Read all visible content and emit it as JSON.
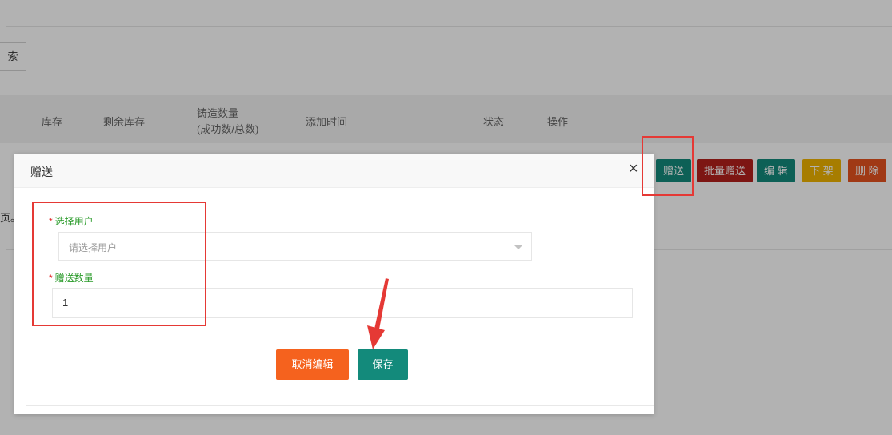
{
  "background_page": {
    "search_button_label": "索",
    "table_headers": {
      "stock": "库存",
      "remaining_stock": "剩余库存",
      "mint_count_line1": "铸造数量",
      "mint_count_line2": "(成功数/总数)",
      "added_time": "添加时间",
      "status": "状态",
      "actions": "操作"
    },
    "row_actions": {
      "gift": "赠送",
      "batch_gift": "批量赠送",
      "edit": "编 辑",
      "unlist": "下 架",
      "delete": "删 除"
    },
    "truncated_text": "页。"
  },
  "modal": {
    "title": "赠送",
    "close_symbol": "×",
    "fields": {
      "user": {
        "required_mark": "*",
        "label": "选择用户",
        "placeholder": "请选择用户"
      },
      "quantity": {
        "required_mark": "*",
        "label": "赠送数量",
        "value": "1"
      }
    },
    "buttons": {
      "cancel": "取消编辑",
      "save": "保存"
    }
  },
  "colors": {
    "gift_button": "#138a7b",
    "batch_gift_button": "#b3201c",
    "edit_button": "#138a7b",
    "unlist_button": "#f0b400",
    "delete_button": "#e6521f",
    "cancel_button": "#f5621e",
    "save_button": "#138a7b",
    "annotation_red": "#e53935",
    "label_green": "#2a9b2a"
  }
}
